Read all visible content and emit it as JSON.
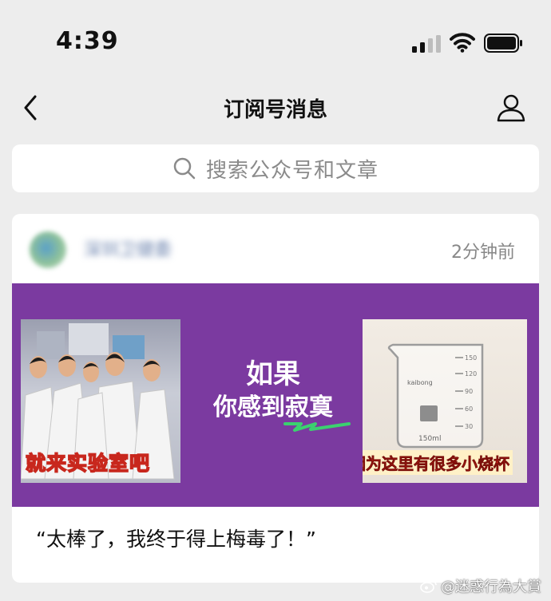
{
  "status_bar": {
    "time": "4:39"
  },
  "nav": {
    "title": "订阅号消息"
  },
  "search": {
    "placeholder": "搜索公众号和文章"
  },
  "card": {
    "account_name": "深圳卫健委",
    "timestamp": "2分钟前",
    "banner": {
      "line1": "如果",
      "line2_prefix": "你感到",
      "line2_highlight": "寂寞",
      "left_caption": "就来实验室吧",
      "right_caption": "因为这里有很多小烧杯",
      "beaker_brand": "kaibong",
      "beaker_volume": "150ml",
      "beaker_ticks": [
        "150",
        "120",
        "90",
        "60",
        "30"
      ]
    },
    "article_title": "“太棒了，我终于得上梅毒了！”"
  },
  "watermark": "@迷惑行為大賞",
  "colors": {
    "banner_bg": "#7b3aa0",
    "page_bg": "#ededed",
    "caption_yellow": "#ffe338",
    "caption_red": "#ff2a1f",
    "highlight_green": "#3bd16f"
  }
}
